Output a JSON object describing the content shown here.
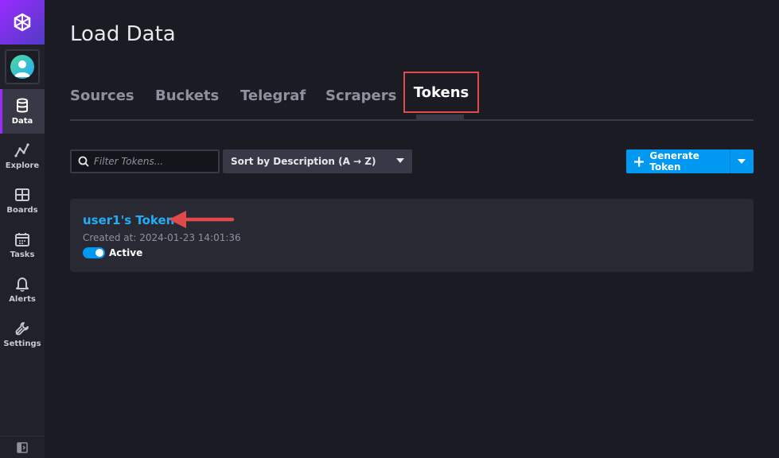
{
  "sidebar": {
    "logo_icon": "influx-cubo-icon",
    "avatar_icon": "user-avatar-icon",
    "items": [
      {
        "label": "Data",
        "icon": "database-icon",
        "active": true
      },
      {
        "label": "Explore",
        "icon": "graph-line-icon"
      },
      {
        "label": "Boards",
        "icon": "dashboard-grid-icon"
      },
      {
        "label": "Tasks",
        "icon": "calendar-icon"
      },
      {
        "label": "Alerts",
        "icon": "bell-icon"
      },
      {
        "label": "Settings",
        "icon": "wrench-icon"
      }
    ],
    "collapse_icon": "sidebar-collapse-icon"
  },
  "page": {
    "title": "Load Data"
  },
  "tabs": [
    {
      "label": "Sources"
    },
    {
      "label": "Buckets"
    },
    {
      "label": "Telegraf"
    },
    {
      "label": "Scrapers"
    },
    {
      "label": "Tokens",
      "active": true
    }
  ],
  "controls": {
    "filter_placeholder": "Filter Tokens...",
    "filter_value": "",
    "sort_label": "Sort by Description (A → Z)",
    "generate_label": "Generate Token"
  },
  "tokens": [
    {
      "name": "user1's Token",
      "created": "Created at: 2024-01-23 14:01:36",
      "status": "Active"
    }
  ],
  "colors": {
    "accent": "#0098f0",
    "link": "#22adf6",
    "highlight": "#e04a4a",
    "background": "#1b1b24"
  }
}
